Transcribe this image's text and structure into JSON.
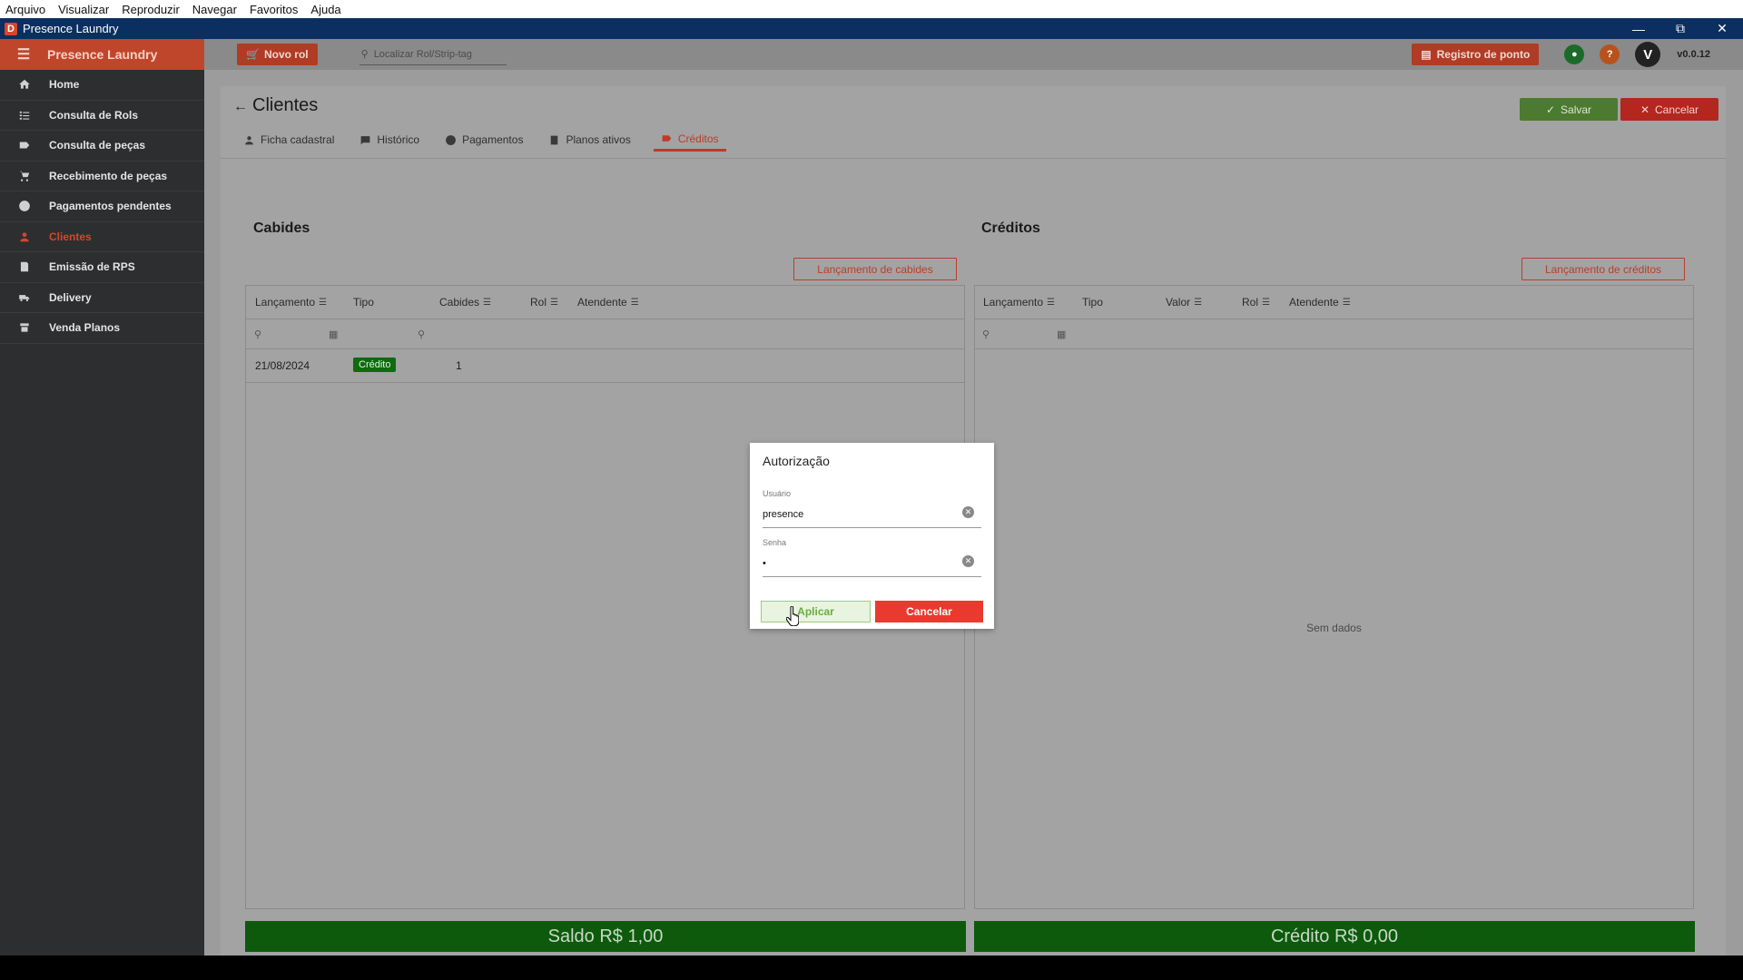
{
  "menubar": [
    "Arquivo",
    "Visualizar",
    "Reproduzir",
    "Navegar",
    "Favoritos",
    "Ajuda"
  ],
  "window": {
    "title": "Presence Laundry",
    "icon_letter": "D"
  },
  "sidebar": {
    "brand": "Presence Laundry",
    "items": [
      {
        "label": "Home",
        "icon": "home-icon"
      },
      {
        "label": "Consulta de Rols",
        "icon": "list-icon"
      },
      {
        "label": "Consulta de peças",
        "icon": "tag-icon"
      },
      {
        "label": "Recebimento de peças",
        "icon": "cart-icon"
      },
      {
        "label": "Pagamentos pendentes",
        "icon": "dollar-icon"
      },
      {
        "label": "Clientes",
        "icon": "person-icon",
        "active": true
      },
      {
        "label": "Emissão de RPS",
        "icon": "receipt-icon"
      },
      {
        "label": "Delivery",
        "icon": "delivery-icon"
      },
      {
        "label": "Venda Planos",
        "icon": "plans-icon"
      }
    ]
  },
  "topbar": {
    "novo_rol": "Novo rol",
    "search_placeholder": "Localizar Rol/Strip-tag",
    "registro_ponto": "Registro de ponto",
    "avatar_letter": "V",
    "version": "v0.0.12"
  },
  "page": {
    "title": "Clientes",
    "salvar": "Salvar",
    "cancelar": "Cancelar",
    "tabs": [
      {
        "label": "Ficha cadastral"
      },
      {
        "label": "Histórico"
      },
      {
        "label": "Pagamentos"
      },
      {
        "label": "Planos ativos"
      },
      {
        "label": "Créditos",
        "active": true
      }
    ]
  },
  "cabides": {
    "title": "Cabides",
    "button": "Lançamento de cabides",
    "columns": [
      "Lançamento",
      "Tipo",
      "Cabides",
      "Rol",
      "Atendente"
    ],
    "rows": [
      {
        "lancamento": "21/08/2024",
        "tipo": "Crédito",
        "cabides": "1"
      }
    ],
    "total": "Saldo R$ 1,00"
  },
  "creditos": {
    "title": "Créditos",
    "button": "Lançamento de créditos",
    "columns": [
      "Lançamento",
      "Tipo",
      "Valor",
      "Rol",
      "Atendente"
    ],
    "empty": "Sem dados",
    "total": "Crédito R$ 0,00"
  },
  "modal": {
    "title": "Autorização",
    "user_label": "Usuário",
    "user_value": "presence",
    "password_label": "Senha",
    "password_value": "•",
    "aplicar": "Aplicar",
    "cancelar": "Cancelar"
  },
  "colors": {
    "accent": "#d8452c",
    "success": "#4c7a30",
    "danger": "#b3271f",
    "total_bar": "#0d5a0d"
  }
}
